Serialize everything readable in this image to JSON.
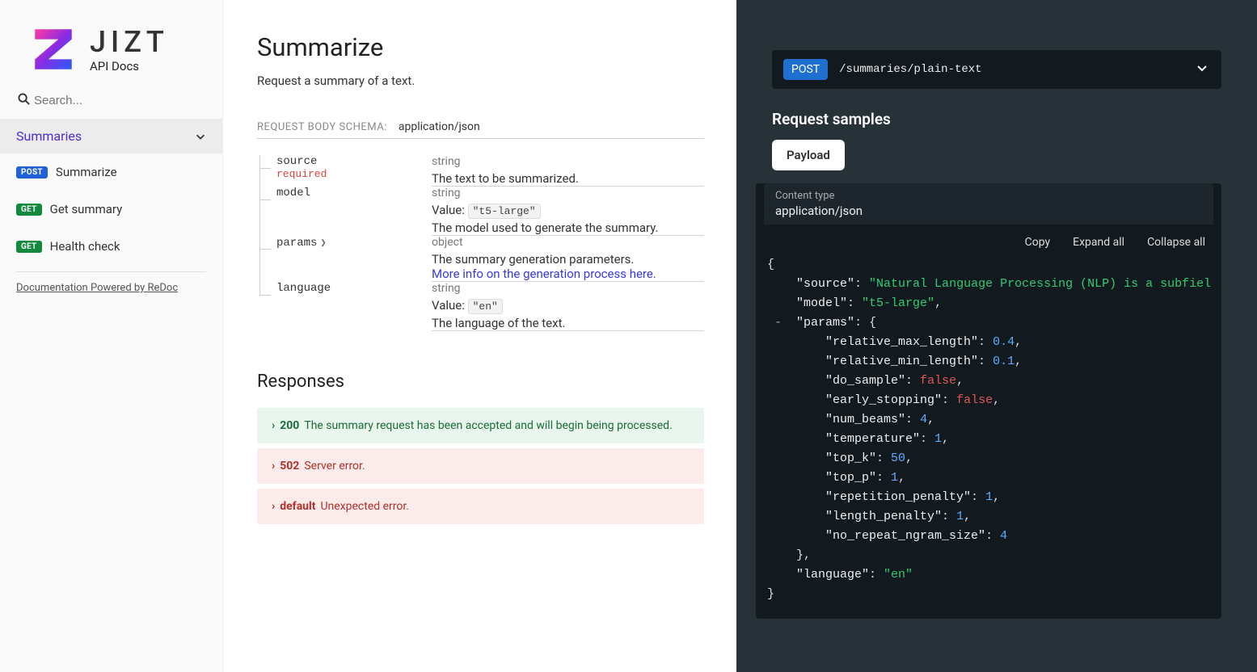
{
  "brand": {
    "name": "JIZT",
    "subtitle": "API Docs"
  },
  "search": {
    "placeholder": "Search..."
  },
  "nav": {
    "section": "Summaries",
    "items": [
      {
        "method": "POST",
        "label": "Summarize"
      },
      {
        "method": "GET",
        "label": "Get summary"
      },
      {
        "method": "GET",
        "label": "Health check"
      }
    ],
    "powered": "Documentation Powered by ReDoc"
  },
  "page": {
    "title": "Summarize",
    "description": "Request a summary of a text.",
    "schema_label": "REQUEST BODY SCHEMA:",
    "schema_type": "application/json"
  },
  "params": {
    "source": {
      "name": "source",
      "required": "required",
      "type": "string",
      "desc": "The text to be summarized."
    },
    "model": {
      "name": "model",
      "type": "string",
      "value_label": "Value:",
      "value": "\"t5-large\"",
      "desc": "The model used to generate the summary."
    },
    "params": {
      "name": "params",
      "type": "object",
      "desc": "The summary generation parameters.",
      "link": "More info on the generation process here."
    },
    "language": {
      "name": "language",
      "type": "string",
      "value_label": "Value:",
      "value": "\"en\"",
      "desc": "The language of the text."
    }
  },
  "responses": {
    "heading": "Responses",
    "r200": {
      "code": "200",
      "text": "The summary request has been accepted and will begin being processed."
    },
    "r502": {
      "code": "502",
      "text": "Server error."
    },
    "rdef": {
      "code": "default",
      "text": "Unexpected error."
    }
  },
  "right": {
    "method": "POST",
    "path": "/summaries/plain-text",
    "samples_heading": "Request samples",
    "tab": "Payload",
    "content_type_label": "Content type",
    "content_type_value": "application/json",
    "actions": {
      "copy": "Copy",
      "expand": "Expand all",
      "collapse": "Collapse all"
    }
  },
  "sample_json": {
    "source": "Natural Language Processing (NLP) is a subfiel",
    "model": "t5-large",
    "params": {
      "relative_max_length": 0.4,
      "relative_min_length": 0.1,
      "do_sample": false,
      "early_stopping": false,
      "num_beams": 4,
      "temperature": 1,
      "top_k": 50,
      "top_p": 1,
      "repetition_penalty": 1,
      "length_penalty": 1,
      "no_repeat_ngram_size": 4
    },
    "language": "en"
  }
}
